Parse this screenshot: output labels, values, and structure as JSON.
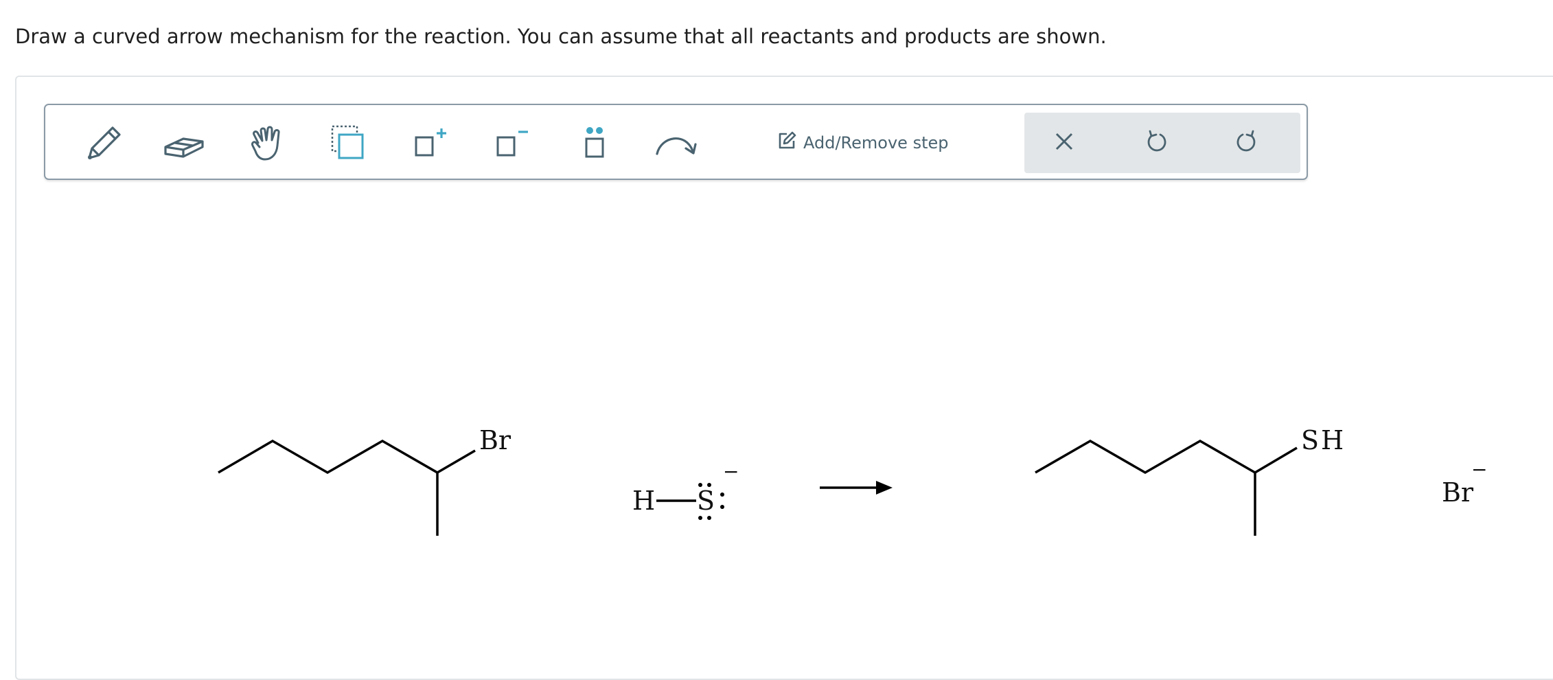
{
  "question": {
    "text": "Draw a curved arrow mechanism for the reaction. You can assume that all reactants and products are shown."
  },
  "toolbar": {
    "tools": [
      {
        "name": "pencil-tool",
        "icon": "pencil-icon"
      },
      {
        "name": "eraser-tool",
        "icon": "eraser-icon"
      },
      {
        "name": "hand-tool",
        "icon": "hand-icon"
      },
      {
        "name": "select-tool",
        "icon": "marquee-select-icon"
      },
      {
        "name": "positive-charge-tool",
        "icon": "positive-charge-icon"
      },
      {
        "name": "negative-charge-tool",
        "icon": "negative-charge-icon"
      },
      {
        "name": "lone-pair-tool",
        "icon": "lone-pair-icon"
      },
      {
        "name": "curved-arrow-tool",
        "icon": "curved-arrow-icon"
      }
    ],
    "add_remove_step_label": "Add/Remove step",
    "actions": [
      {
        "name": "clear-button",
        "icon": "close-icon"
      },
      {
        "name": "undo-button",
        "icon": "undo-icon"
      },
      {
        "name": "redo-button",
        "icon": "redo-icon"
      }
    ],
    "accent_color": "#3fa6c4",
    "icon_color": "#4a6370"
  },
  "reaction": {
    "reactant1_substituent": "Br",
    "reactant2_H": "H",
    "reactant2_S": "S",
    "reactant2_charge": "−",
    "product1_substituent": "SH",
    "product2_label": "Br",
    "product2_charge": "−"
  }
}
